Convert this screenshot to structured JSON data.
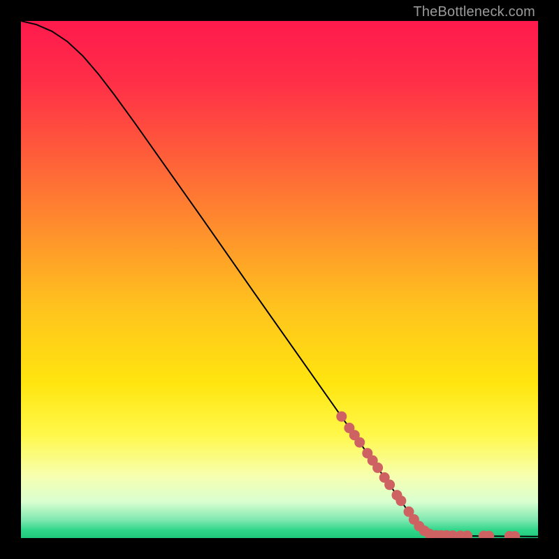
{
  "watermark": "TheBottleneck.com",
  "chart_data": {
    "type": "line",
    "title": "",
    "xlabel": "",
    "ylabel": "",
    "xlim": [
      0,
      100
    ],
    "ylim": [
      0,
      100
    ],
    "background_gradient": {
      "stops": [
        {
          "offset": 0.0,
          "color": "#ff1a4d"
        },
        {
          "offset": 0.12,
          "color": "#ff2f47"
        },
        {
          "offset": 0.25,
          "color": "#ff5a3b"
        },
        {
          "offset": 0.4,
          "color": "#ff8e2d"
        },
        {
          "offset": 0.55,
          "color": "#ffc21e"
        },
        {
          "offset": 0.7,
          "color": "#ffe50f"
        },
        {
          "offset": 0.8,
          "color": "#fff84a"
        },
        {
          "offset": 0.88,
          "color": "#f7ffb0"
        },
        {
          "offset": 0.93,
          "color": "#d9ffd0"
        },
        {
          "offset": 0.965,
          "color": "#7fe8b0"
        },
        {
          "offset": 0.985,
          "color": "#2fd68a"
        },
        {
          "offset": 1.0,
          "color": "#1fc97b"
        }
      ]
    },
    "series": [
      {
        "name": "curve",
        "type": "line",
        "color": "#000000",
        "points": [
          {
            "x": 0.0,
            "y": 100.0
          },
          {
            "x": 3.0,
            "y": 99.3
          },
          {
            "x": 6.0,
            "y": 98.0
          },
          {
            "x": 9.0,
            "y": 96.0
          },
          {
            "x": 12.0,
            "y": 93.2
          },
          {
            "x": 15.0,
            "y": 89.7
          },
          {
            "x": 18.0,
            "y": 85.8
          },
          {
            "x": 22.0,
            "y": 80.3
          },
          {
            "x": 28.0,
            "y": 71.8
          },
          {
            "x": 35.0,
            "y": 61.9
          },
          {
            "x": 45.0,
            "y": 47.6
          },
          {
            "x": 55.0,
            "y": 33.4
          },
          {
            "x": 65.0,
            "y": 19.2
          },
          {
            "x": 72.0,
            "y": 9.3
          },
          {
            "x": 76.0,
            "y": 3.6
          },
          {
            "x": 78.5,
            "y": 1.2
          },
          {
            "x": 80.0,
            "y": 0.5
          },
          {
            "x": 85.0,
            "y": 0.4
          },
          {
            "x": 92.0,
            "y": 0.35
          },
          {
            "x": 100.0,
            "y": 0.3
          }
        ]
      },
      {
        "name": "highlight-markers",
        "type": "scatter",
        "color": "#ce6262",
        "points": [
          {
            "x": 62.0,
            "y": 23.5
          },
          {
            "x": 63.5,
            "y": 21.3
          },
          {
            "x": 64.5,
            "y": 19.9
          },
          {
            "x": 65.5,
            "y": 18.5
          },
          {
            "x": 67.0,
            "y": 16.4
          },
          {
            "x": 68.0,
            "y": 15.0
          },
          {
            "x": 69.0,
            "y": 13.6
          },
          {
            "x": 70.3,
            "y": 11.7
          },
          {
            "x": 71.3,
            "y": 10.3
          },
          {
            "x": 72.7,
            "y": 8.3
          },
          {
            "x": 73.5,
            "y": 7.2
          },
          {
            "x": 75.0,
            "y": 5.1
          },
          {
            "x": 76.0,
            "y": 3.6
          },
          {
            "x": 77.0,
            "y": 2.3
          },
          {
            "x": 78.0,
            "y": 1.4
          },
          {
            "x": 79.0,
            "y": 0.8
          },
          {
            "x": 80.3,
            "y": 0.5
          },
          {
            "x": 81.3,
            "y": 0.5
          },
          {
            "x": 82.3,
            "y": 0.5
          },
          {
            "x": 83.5,
            "y": 0.47
          },
          {
            "x": 85.0,
            "y": 0.45
          },
          {
            "x": 86.3,
            "y": 0.43
          },
          {
            "x": 89.5,
            "y": 0.4
          },
          {
            "x": 90.5,
            "y": 0.39
          },
          {
            "x": 94.5,
            "y": 0.35
          },
          {
            "x": 95.5,
            "y": 0.34
          }
        ]
      }
    ]
  }
}
